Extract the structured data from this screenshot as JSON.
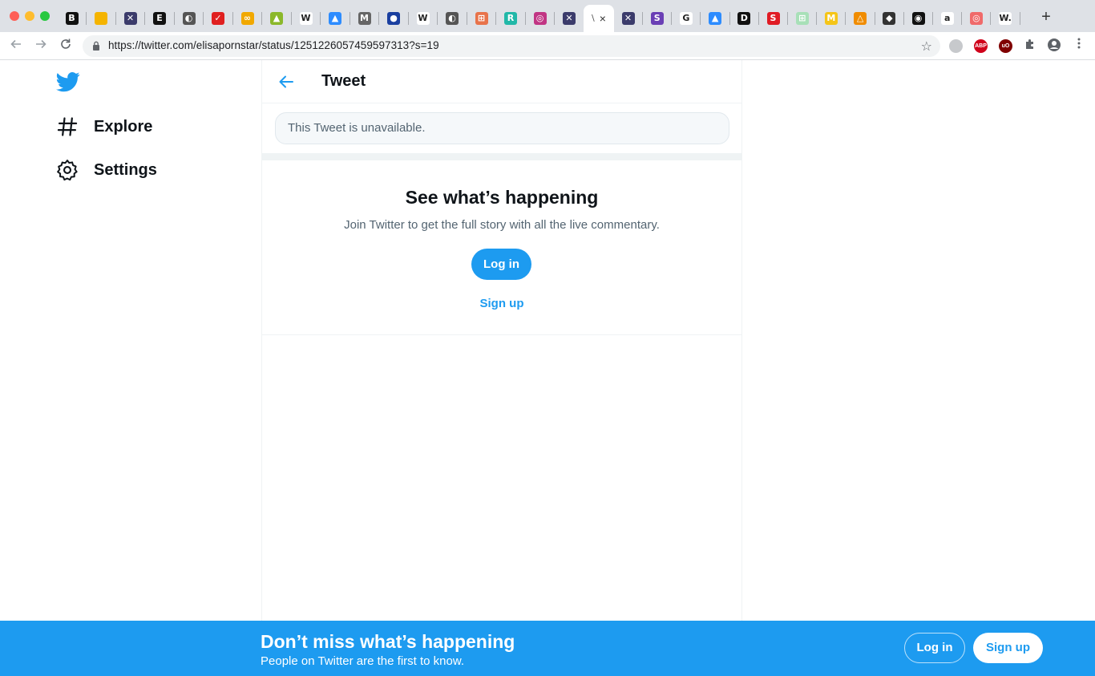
{
  "browser": {
    "url": "https://twitter.com/elisapornstar/status/1251226057459597313?s=19",
    "tabs": [
      {
        "glyph": "B",
        "bg": "#111111",
        "icon": "b-favicon-icon"
      },
      {
        "glyph": "",
        "bg": "#f5b400",
        "icon": "slides-favicon-icon"
      },
      {
        "glyph": "✕",
        "bg": "#3b3b6b",
        "icon": "x-favicon-icon"
      },
      {
        "glyph": "E",
        "bg": "#111111",
        "icon": "e-favicon-icon"
      },
      {
        "glyph": "◐",
        "bg": "#555555",
        "icon": "globe-favicon-icon"
      },
      {
        "glyph": "✓",
        "bg": "#e02020",
        "icon": "pocket-favicon-icon"
      },
      {
        "glyph": "∞",
        "bg": "#f1a800",
        "icon": "infinity-favicon-icon"
      },
      {
        "glyph": "▲",
        "bg": "#8bb82a",
        "icon": "green-favicon-icon"
      },
      {
        "glyph": "W",
        "bg": "#ffffff",
        "icon": "wikipedia-favicon-icon"
      },
      {
        "glyph": "▲",
        "bg": "#2d8cff",
        "icon": "drive-favicon-icon"
      },
      {
        "glyph": "M",
        "bg": "#666666",
        "icon": "m-favicon-icon"
      },
      {
        "glyph": "●",
        "bg": "#1a3fa0",
        "icon": "blue-dot-favicon-icon"
      },
      {
        "glyph": "W",
        "bg": "#ffffff",
        "icon": "wikipedia-favicon-icon"
      },
      {
        "glyph": "◐",
        "bg": "#555555",
        "icon": "globe-favicon-icon"
      },
      {
        "glyph": "⊞",
        "bg": "#e8734a",
        "icon": "grid-favicon-icon"
      },
      {
        "glyph": "R",
        "bg": "#21b8a8",
        "icon": "r-favicon-icon"
      },
      {
        "glyph": "◎",
        "bg": "#c13584",
        "icon": "instagram-favicon-icon"
      },
      {
        "glyph": "✕",
        "bg": "#3b3b6b",
        "icon": "x-favicon-icon"
      }
    ],
    "active_tab": {
      "glyph": "\\",
      "close": "×"
    },
    "tabs_after": [
      {
        "glyph": "✕",
        "bg": "#3b3b6b",
        "icon": "x-favicon-icon"
      },
      {
        "glyph": "S",
        "bg": "#6a3fb5",
        "icon": "s-favicon-icon"
      },
      {
        "glyph": "G",
        "bg": "#ffffff",
        "icon": "google-favicon-icon"
      },
      {
        "glyph": "▲",
        "bg": "#2d8cff",
        "icon": "drive-favicon-icon"
      },
      {
        "glyph": "D",
        "bg": "#111111",
        "icon": "d-favicon-icon"
      },
      {
        "glyph": "S",
        "bg": "#e01b24",
        "icon": "s-red-favicon-icon"
      },
      {
        "glyph": "⊞",
        "bg": "#a8e0b8",
        "icon": "sheet-favicon-icon"
      },
      {
        "glyph": "M",
        "bg": "#f5c518",
        "icon": "miro-favicon-icon"
      },
      {
        "glyph": "△",
        "bg": "#f08c00",
        "icon": "triangle-favicon-icon"
      },
      {
        "glyph": "◆",
        "bg": "#333333",
        "icon": "diamond-favicon-icon"
      },
      {
        "glyph": "◉",
        "bg": "#111111",
        "icon": "black-circle-favicon-icon"
      },
      {
        "glyph": "a",
        "bg": "#ffffff",
        "icon": "amazon-favicon-icon"
      },
      {
        "glyph": "◎",
        "bg": "#f06a6a",
        "icon": "target-favicon-icon"
      },
      {
        "glyph": "W.",
        "bg": "#ffffff",
        "icon": "w-dot-favicon-icon"
      }
    ],
    "new_tab": "+",
    "extensions": [
      {
        "label": "",
        "bg": "#c7c9cc",
        "icon": "storage-extension-icon"
      },
      {
        "label": "ABP",
        "bg": "#d0021b",
        "icon": "adblock-extension-icon"
      },
      {
        "label": "uO",
        "bg": "#800000",
        "icon": "ublock-extension-icon"
      }
    ]
  },
  "twitter": {
    "nav": [
      {
        "label": "Explore",
        "icon": "hashtag-icon"
      },
      {
        "label": "Settings",
        "icon": "gear-icon"
      }
    ],
    "header_title": "Tweet",
    "unavailable_text": "This Tweet is unavailable.",
    "cta": {
      "title": "See what’s happening",
      "subtitle": "Join Twitter to get the full story with all the live commentary.",
      "login": "Log in",
      "signup": "Sign up"
    },
    "banner": {
      "title": "Don’t miss what’s happening",
      "subtitle": "People on Twitter are the first to know.",
      "login": "Log in",
      "signup": "Sign up"
    },
    "colors": {
      "accent": "#1d9bf0",
      "text": "#0f1419",
      "muted": "#536471"
    }
  }
}
